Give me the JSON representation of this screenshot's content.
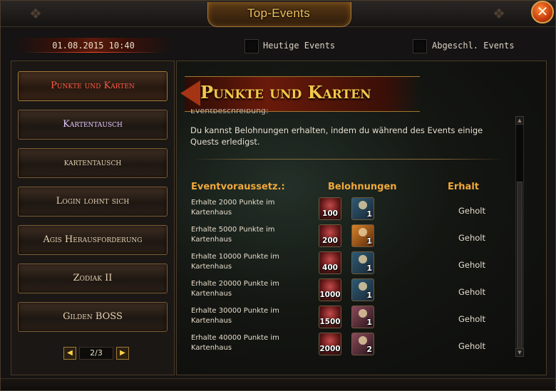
{
  "window": {
    "title": "Top-Events",
    "close_label": "✕"
  },
  "header": {
    "datetime": "01.08.2015 10:40",
    "checkboxes": [
      {
        "label": "Heutige Events",
        "checked": false
      },
      {
        "label": "Abgeschl. Events",
        "checked": false
      }
    ]
  },
  "sidebar": {
    "items": [
      {
        "label": "Punkte und Karten",
        "state": "active"
      },
      {
        "label": "Kartentausch",
        "state": "highlight"
      },
      {
        "label": "kartentausch",
        "state": "normal"
      },
      {
        "label": "Login lohnt sich",
        "state": "normal"
      },
      {
        "label": "Agis Herausforderung",
        "state": "normal"
      },
      {
        "label": "Zodiak II",
        "state": "normal"
      },
      {
        "label": "Gilden BOSS",
        "state": "normal"
      }
    ],
    "pager": {
      "prev_icon": "arrow-left-icon",
      "next_icon": "arrow-right-icon",
      "indicator": "2/3"
    }
  },
  "main": {
    "banner_title": "Punkte und Karten",
    "cut_heading": "Eventbeschreibung:",
    "description": "Du kannst Belohnungen erhalten, indem du während des Events einige Quests erledigst.",
    "columns": {
      "requirement": "Eventvoraussetz.:",
      "rewards": "Belohnungen",
      "status": "Erhalt"
    },
    "rows": [
      {
        "line1": "Erhalte 2000 Punkte im",
        "line2": "Kartenhaus",
        "points": "100",
        "card_count": "1",
        "card_color": "blue",
        "status": "Geholt"
      },
      {
        "line1": "Erhalte 5000 Punkte im",
        "line2": "Kartenhaus",
        "points": "200",
        "card_count": "1",
        "card_color": "gold",
        "status": "Geholt"
      },
      {
        "line1": "Erhalte 10000 Punkte im",
        "line2": "Kartenhaus",
        "points": "400",
        "card_count": "1",
        "card_color": "blue",
        "status": "Geholt"
      },
      {
        "line1": "Erhalte 20000 Punkte im",
        "line2": "Kartenhaus",
        "points": "1000",
        "card_count": "1",
        "card_color": "blue",
        "status": "Geholt"
      },
      {
        "line1": "Erhalte 30000 Punkte im",
        "line2": "Kartenhaus",
        "points": "1500",
        "card_count": "1",
        "card_color": "pink",
        "status": "Geholt"
      },
      {
        "line1": "Erhalte 40000 Punkte im",
        "line2": "Kartenhaus",
        "points": "2000",
        "card_count": "2",
        "card_color": "pink",
        "status": "Geholt"
      }
    ]
  },
  "colors": {
    "accent_gold": "#f2c94a",
    "active_red": "#ff5a46",
    "header_orange": "#f0a93a"
  }
}
